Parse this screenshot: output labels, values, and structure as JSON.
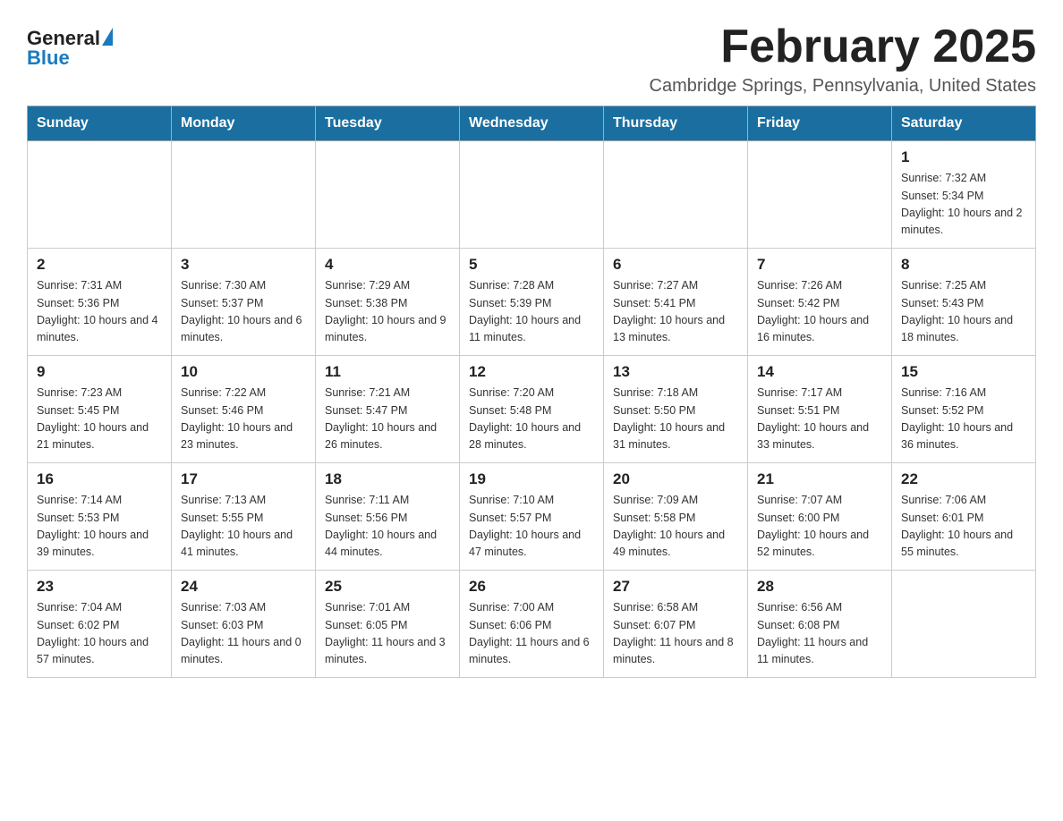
{
  "header": {
    "logo_text_general": "General",
    "logo_text_blue": "Blue",
    "month_title": "February 2025",
    "location": "Cambridge Springs, Pennsylvania, United States"
  },
  "days_of_week": [
    "Sunday",
    "Monday",
    "Tuesday",
    "Wednesday",
    "Thursday",
    "Friday",
    "Saturday"
  ],
  "weeks": [
    [
      {
        "day": "",
        "info": ""
      },
      {
        "day": "",
        "info": ""
      },
      {
        "day": "",
        "info": ""
      },
      {
        "day": "",
        "info": ""
      },
      {
        "day": "",
        "info": ""
      },
      {
        "day": "",
        "info": ""
      },
      {
        "day": "1",
        "info": "Sunrise: 7:32 AM\nSunset: 5:34 PM\nDaylight: 10 hours and 2 minutes."
      }
    ],
    [
      {
        "day": "2",
        "info": "Sunrise: 7:31 AM\nSunset: 5:36 PM\nDaylight: 10 hours and 4 minutes."
      },
      {
        "day": "3",
        "info": "Sunrise: 7:30 AM\nSunset: 5:37 PM\nDaylight: 10 hours and 6 minutes."
      },
      {
        "day": "4",
        "info": "Sunrise: 7:29 AM\nSunset: 5:38 PM\nDaylight: 10 hours and 9 minutes."
      },
      {
        "day": "5",
        "info": "Sunrise: 7:28 AM\nSunset: 5:39 PM\nDaylight: 10 hours and 11 minutes."
      },
      {
        "day": "6",
        "info": "Sunrise: 7:27 AM\nSunset: 5:41 PM\nDaylight: 10 hours and 13 minutes."
      },
      {
        "day": "7",
        "info": "Sunrise: 7:26 AM\nSunset: 5:42 PM\nDaylight: 10 hours and 16 minutes."
      },
      {
        "day": "8",
        "info": "Sunrise: 7:25 AM\nSunset: 5:43 PM\nDaylight: 10 hours and 18 minutes."
      }
    ],
    [
      {
        "day": "9",
        "info": "Sunrise: 7:23 AM\nSunset: 5:45 PM\nDaylight: 10 hours and 21 minutes."
      },
      {
        "day": "10",
        "info": "Sunrise: 7:22 AM\nSunset: 5:46 PM\nDaylight: 10 hours and 23 minutes."
      },
      {
        "day": "11",
        "info": "Sunrise: 7:21 AM\nSunset: 5:47 PM\nDaylight: 10 hours and 26 minutes."
      },
      {
        "day": "12",
        "info": "Sunrise: 7:20 AM\nSunset: 5:48 PM\nDaylight: 10 hours and 28 minutes."
      },
      {
        "day": "13",
        "info": "Sunrise: 7:18 AM\nSunset: 5:50 PM\nDaylight: 10 hours and 31 minutes."
      },
      {
        "day": "14",
        "info": "Sunrise: 7:17 AM\nSunset: 5:51 PM\nDaylight: 10 hours and 33 minutes."
      },
      {
        "day": "15",
        "info": "Sunrise: 7:16 AM\nSunset: 5:52 PM\nDaylight: 10 hours and 36 minutes."
      }
    ],
    [
      {
        "day": "16",
        "info": "Sunrise: 7:14 AM\nSunset: 5:53 PM\nDaylight: 10 hours and 39 minutes."
      },
      {
        "day": "17",
        "info": "Sunrise: 7:13 AM\nSunset: 5:55 PM\nDaylight: 10 hours and 41 minutes."
      },
      {
        "day": "18",
        "info": "Sunrise: 7:11 AM\nSunset: 5:56 PM\nDaylight: 10 hours and 44 minutes."
      },
      {
        "day": "19",
        "info": "Sunrise: 7:10 AM\nSunset: 5:57 PM\nDaylight: 10 hours and 47 minutes."
      },
      {
        "day": "20",
        "info": "Sunrise: 7:09 AM\nSunset: 5:58 PM\nDaylight: 10 hours and 49 minutes."
      },
      {
        "day": "21",
        "info": "Sunrise: 7:07 AM\nSunset: 6:00 PM\nDaylight: 10 hours and 52 minutes."
      },
      {
        "day": "22",
        "info": "Sunrise: 7:06 AM\nSunset: 6:01 PM\nDaylight: 10 hours and 55 minutes."
      }
    ],
    [
      {
        "day": "23",
        "info": "Sunrise: 7:04 AM\nSunset: 6:02 PM\nDaylight: 10 hours and 57 minutes."
      },
      {
        "day": "24",
        "info": "Sunrise: 7:03 AM\nSunset: 6:03 PM\nDaylight: 11 hours and 0 minutes."
      },
      {
        "day": "25",
        "info": "Sunrise: 7:01 AM\nSunset: 6:05 PM\nDaylight: 11 hours and 3 minutes."
      },
      {
        "day": "26",
        "info": "Sunrise: 7:00 AM\nSunset: 6:06 PM\nDaylight: 11 hours and 6 minutes."
      },
      {
        "day": "27",
        "info": "Sunrise: 6:58 AM\nSunset: 6:07 PM\nDaylight: 11 hours and 8 minutes."
      },
      {
        "day": "28",
        "info": "Sunrise: 6:56 AM\nSunset: 6:08 PM\nDaylight: 11 hours and 11 minutes."
      },
      {
        "day": "",
        "info": ""
      }
    ]
  ]
}
